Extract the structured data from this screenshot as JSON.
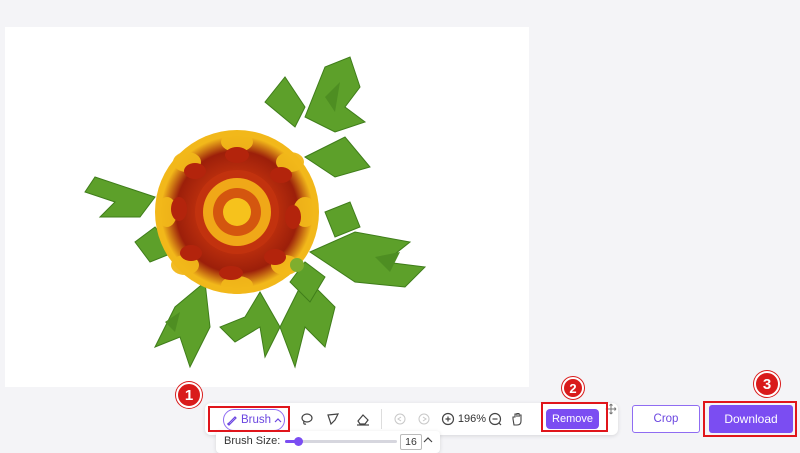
{
  "toolbar": {
    "brush_label": "Brush",
    "zoom_level": "196%",
    "remove_label": "Remove"
  },
  "actions": {
    "crop_label": "Crop",
    "download_label": "Download"
  },
  "brush_panel": {
    "label": "Brush Size:",
    "size_value": "16",
    "slider_fraction": 0.12
  },
  "callouts": {
    "step1": "1",
    "step2": "2",
    "step3": "3"
  },
  "colors": {
    "accent": "#7b4df2",
    "highlight": "#e0151b",
    "badge": "#d91b1b"
  },
  "icons": [
    "paintbrush-icon",
    "chevron-up-icon",
    "lasso-icon",
    "polygon-lasso-icon",
    "eraser-icon",
    "undo-icon",
    "redo-icon",
    "zoom-in-icon",
    "zoom-out-icon",
    "hand-icon",
    "move-icon"
  ]
}
